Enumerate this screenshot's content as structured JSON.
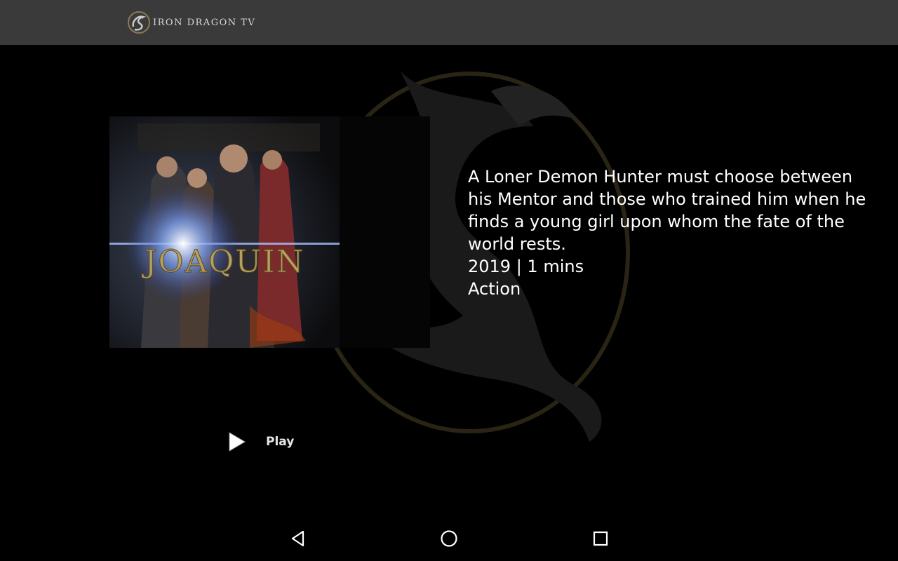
{
  "app": {
    "title": "IRON DRAGON TV"
  },
  "movie": {
    "poster_title": "JOAQUIN",
    "description": "A Loner Demon Hunter must choose between his Mentor and those who trained him when he finds a young girl upon whom the fate of the world rests.",
    "year_runtime": "2019 | 1 mins",
    "genre": "Action"
  },
  "actions": {
    "play_label": "Play"
  },
  "icons": {
    "logo": "dragon-logo-icon",
    "play": "play-icon",
    "back": "back-triangle-icon",
    "home": "home-circle-icon",
    "recents": "recents-square-icon"
  },
  "colors": {
    "topbar": "#3a3a3a",
    "background": "#000000",
    "title_gold": "#b8a060"
  }
}
